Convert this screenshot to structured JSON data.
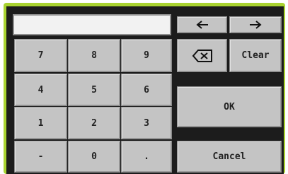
{
  "display": {
    "value": ""
  },
  "nav": {
    "left_icon": "arrow-left-icon",
    "right_icon": "arrow-right-icon"
  },
  "keys": {
    "k7": "7",
    "k8": "8",
    "k9": "9",
    "k4": "4",
    "k5": "5",
    "k6": "6",
    "k1": "1",
    "k2": "2",
    "k3": "3",
    "minus": "-",
    "k0": "0",
    "dot": "."
  },
  "actions": {
    "backspace_icon": "backspace-icon",
    "clear": "Clear",
    "ok": "OK",
    "cancel": "Cancel"
  },
  "colors": {
    "frame": "#a9d330",
    "panel": "#1c1c1c",
    "key": "#c4c4c4",
    "display": "#f2f2f2"
  }
}
